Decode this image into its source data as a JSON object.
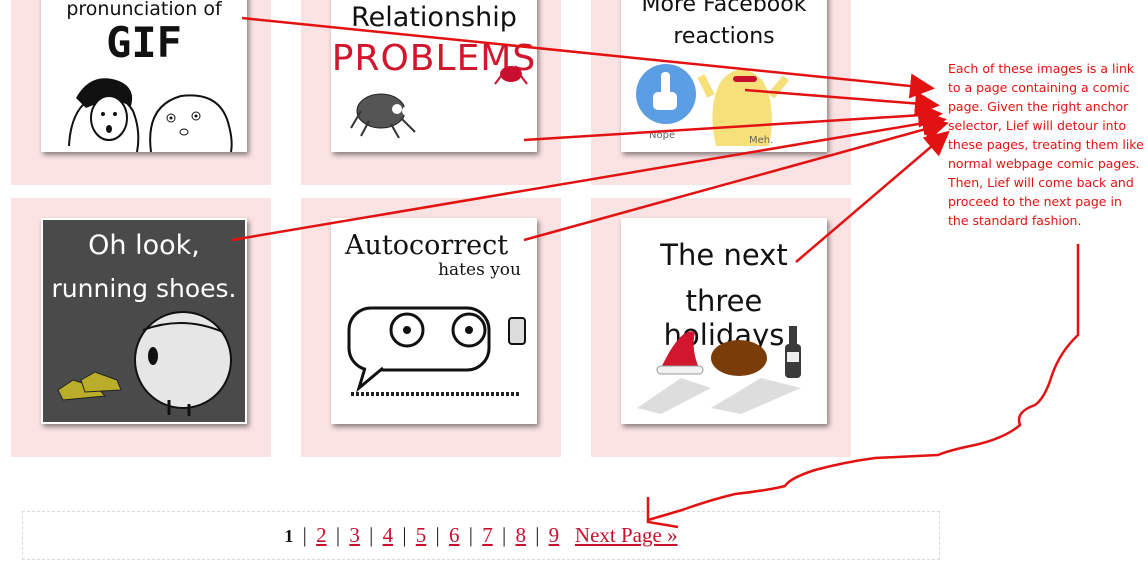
{
  "comics": [
    {
      "title_line1": "pronunciation of",
      "title_line2": "GIF"
    },
    {
      "title_line1": "Relationship",
      "title_line2": "PROBLEMS"
    },
    {
      "title_line1": "More Facebook",
      "title_line2": "reactions",
      "label_a": "Nope",
      "label_b": "Meh."
    },
    {
      "title_line1": "Oh look,",
      "title_line2": "running shoes."
    },
    {
      "title_line1": "Autocorrect",
      "title_line2": "hates you"
    },
    {
      "title_line1": "The next",
      "title_line2": "three holidays"
    }
  ],
  "annotation": {
    "text": "Each of these images is a link to a page containing a comic page. Given the right anchor selector, Lief will detour into these pages, treating them like normal webpage comic pages. Then, Lief will come back and proceed to the next page in the standard fashion."
  },
  "pagination": {
    "current": "1",
    "pages": [
      "2",
      "3",
      "4",
      "5",
      "6",
      "7",
      "8",
      "9"
    ],
    "separator": "|",
    "next_label": "Next Page »"
  },
  "colors": {
    "cell_bg": "#fbe3e3",
    "link": "#c8102e",
    "annotation": "#e31212"
  }
}
